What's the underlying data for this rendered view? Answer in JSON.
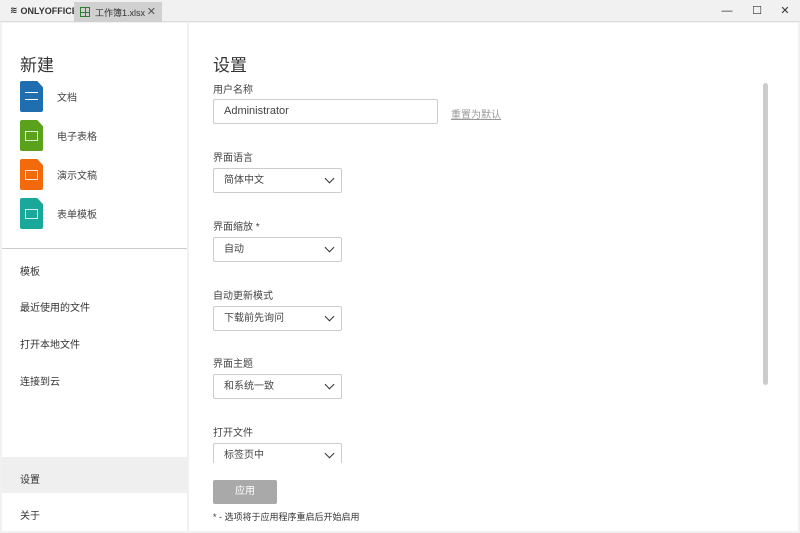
{
  "app": {
    "brand": "ONLYOFFICE",
    "tab": "工作簿1.xlsx",
    "win_min": "—",
    "win_max": "☐",
    "win_close": "✕",
    "tab_close": "✕"
  },
  "sidebar": {
    "title": "新建",
    "new": [
      {
        "label": "文档",
        "color": "#1f6fb0"
      },
      {
        "label": "电子表格",
        "color": "#5aa11c"
      },
      {
        "label": "演示文稿",
        "color": "#f26a0c"
      },
      {
        "label": "表单模板",
        "color": "#1aa89a"
      }
    ],
    "nav": [
      "模板",
      "最近使用的文件",
      "打开本地文件",
      "连接到云"
    ],
    "bottom": [
      "设置",
      "关于"
    ]
  },
  "settings": {
    "title": "设置",
    "username_label": "用户名称",
    "username_value": "Administrator",
    "reset": "重置为默认",
    "fields": [
      {
        "label": "界面语言",
        "value": "简体中文"
      },
      {
        "label": "界面缩放 *",
        "value": "自动"
      },
      {
        "label": "自动更新模式",
        "value": "下载前先询问"
      },
      {
        "label": "界面主题",
        "value": "和系统一致"
      },
      {
        "label": "打开文件",
        "value": "标签页中"
      }
    ],
    "apply": "应用",
    "note": "* - 选项将于应用程序重启后开始启用"
  }
}
